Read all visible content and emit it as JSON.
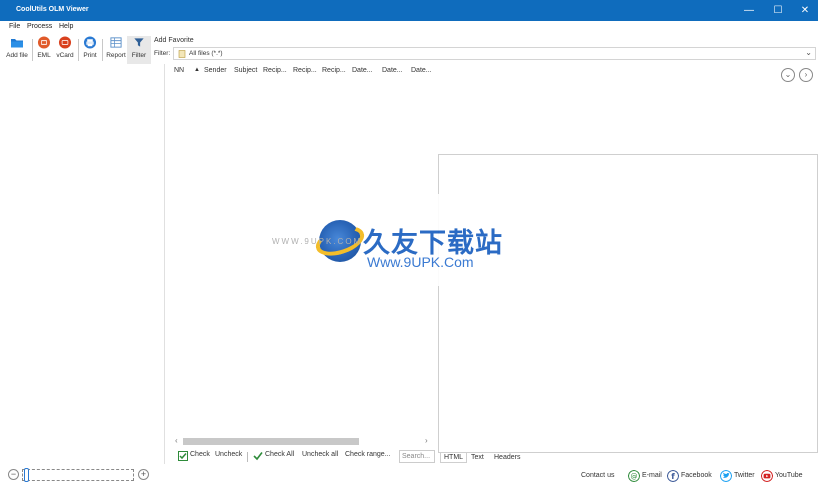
{
  "window": {
    "title": "CoolUtils OLM Viewer",
    "minimize_glyph": "—",
    "maximize_glyph": "☐",
    "close_glyph": "✕"
  },
  "menu": [
    "File",
    "Process",
    "Help"
  ],
  "toolbar": {
    "add_file": "Add file",
    "eml": "EML",
    "vcard": "vCard",
    "print": "Print",
    "report": "Report",
    "filter": "Filter"
  },
  "favorites": {
    "label": "Add Favorite"
  },
  "filter": {
    "label": "Filter:",
    "value": "All files (*.*)"
  },
  "columns": [
    "NN",
    "▲",
    "Sender",
    "Subject",
    "Recip...",
    "Recip...",
    "Recip...",
    "Date...",
    "Date...",
    "Date..."
  ],
  "watermark": {
    "brand_cn": "久友下载站",
    "url": "Www.9UPK.Com",
    "small": "WWW.9UPK.COM"
  },
  "check_bar": {
    "check": "Check",
    "uncheck": "Uncheck",
    "check_all": "Check All",
    "uncheck_all": "Uncheck all",
    "check_range": "Check range...",
    "search_placeholder": "Search..."
  },
  "preview_tabs": [
    "HTML",
    "Text",
    "Headers"
  ],
  "footer": {
    "contact": "Contact us",
    "email": "E-mail",
    "facebook": "Facebook",
    "twitter": "Twitter",
    "youtube": "YouTube"
  },
  "colors": {
    "titlebar": "#0f6cbd",
    "accent": "#2a7ad3"
  }
}
